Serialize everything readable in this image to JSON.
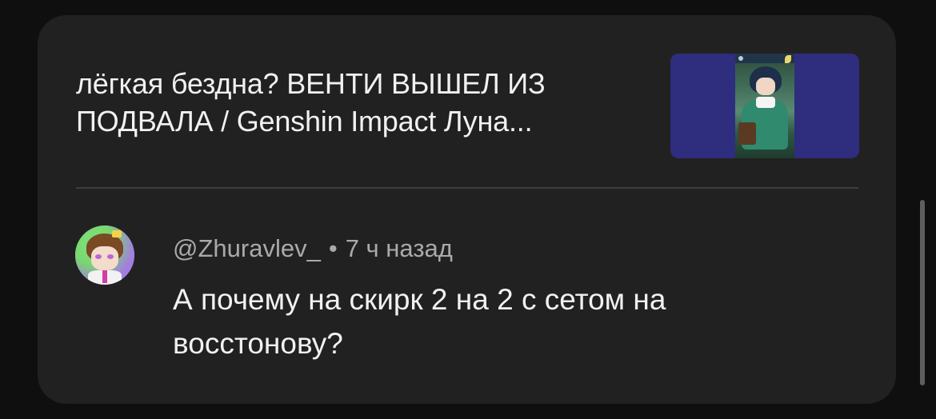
{
  "video": {
    "title": "лёгкая бездна? ВЕНТИ ВЫШЕЛ ИЗ ПОДВАЛА / Genshin Impact Луна..."
  },
  "comment": {
    "author": "@Zhuravlev_",
    "separator": "•",
    "time": "7 ч назад",
    "text": "А почему на скирк 2 на 2 с сетом на восстонову?"
  },
  "colors": {
    "background": "#0f0f0f",
    "card": "#212121",
    "thumbnail_bg": "#2e2d7e",
    "primary_text": "#f1f1f1",
    "secondary_text": "#aaaaaa"
  }
}
